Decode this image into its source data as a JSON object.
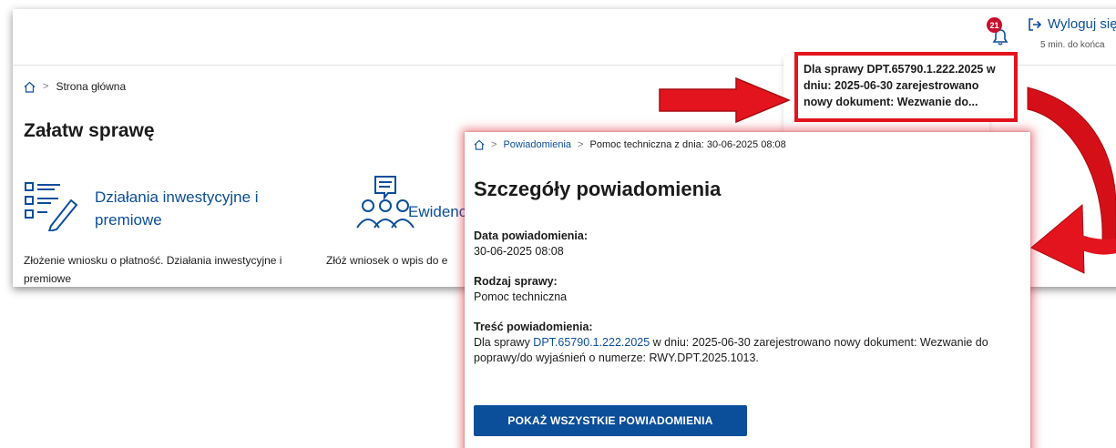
{
  "header": {
    "notification_count": "21",
    "logout_label": "Wyloguj się",
    "session_timer": "5 min. do końca"
  },
  "breadcrumb_main": {
    "home": "Strona główna"
  },
  "main": {
    "title": "Załatw sprawę",
    "tiles": [
      {
        "title": "Działania inwestycyjne i premiowe",
        "description": "Złożenie wniosku o płatność. Działania inwestycyjne i premiowe"
      },
      {
        "title": "Ewidenc",
        "description": "Złóż wniosek o wpis do e"
      }
    ]
  },
  "notification_popup": {
    "highlighted_text": "Dla sprawy DPT.65790.1.222.2025 w dniu: 2025-06-30 zarejestrowano nowy dokument: Wezwanie do..."
  },
  "detail": {
    "breadcrumb": {
      "notifications": "Powiadomienia",
      "current": "Pomoc techniczna z dnia: 30-06-2025 08:08"
    },
    "title": "Szczegóły powiadomienia",
    "date_label": "Data powiadomienia:",
    "date_value": "30-06-2025 08:08",
    "type_label": "Rodzaj sprawy:",
    "type_value": "Pomoc techniczna",
    "content_label": "Treść powiadomienia:",
    "content_prefix": "Dla sprawy ",
    "content_link": "DPT.65790.1.222.2025",
    "content_suffix": " w dniu: 2025-06-30 zarejestrowano nowy dokument: Wezwanie do poprawy/do wyjaśnień o numerze: RWY.DPT.2025.1013.",
    "show_all_button": "POKAŻ WSZYSTKIE POWIADOMIENIA"
  },
  "colors": {
    "brand_blue": "#0b4e9a",
    "alert_red": "#e3141d",
    "badge_red": "#c8102e"
  }
}
